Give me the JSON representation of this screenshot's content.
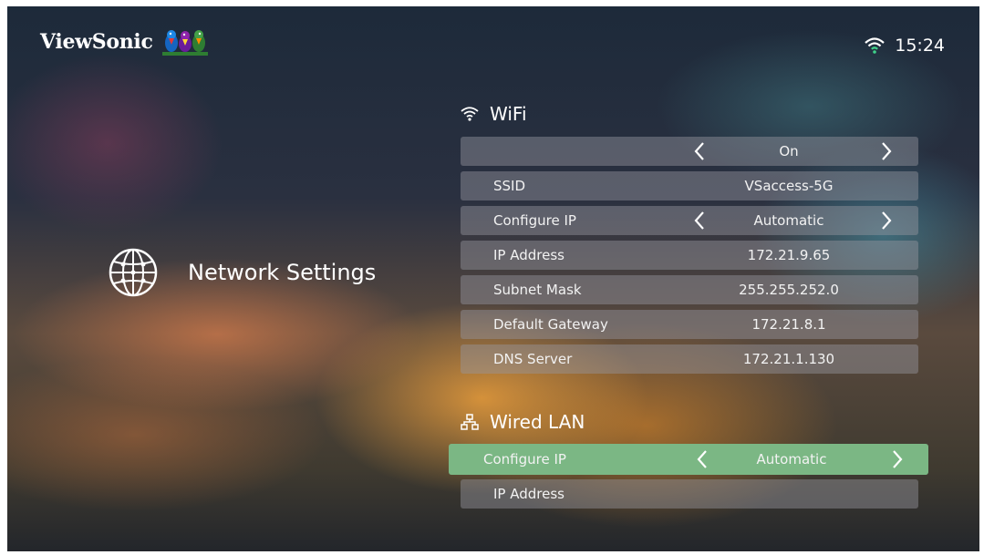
{
  "brand": {
    "logo_text": "ViewSonic"
  },
  "status_bar": {
    "time": "15:24",
    "wifi_icon": "wifi-icon"
  },
  "page": {
    "title": "Network Settings",
    "icon": "globe-icon"
  },
  "wifi": {
    "heading": "WiFi",
    "toggle": {
      "value": "On"
    },
    "ssid": {
      "label": "SSID",
      "value": "VSaccess-5G"
    },
    "configure_ip": {
      "label": "Configure IP",
      "value": "Automatic"
    },
    "ip_address": {
      "label": "IP Address",
      "value": "172.21.9.65"
    },
    "subnet_mask": {
      "label": "Subnet Mask",
      "value": "255.255.252.0"
    },
    "default_gateway": {
      "label": "Default Gateway",
      "value": "172.21.8.1"
    },
    "dns_server": {
      "label": "DNS Server",
      "value": "172.21.1.130"
    }
  },
  "wired": {
    "heading": "Wired LAN",
    "configure_ip": {
      "label": "Configure IP",
      "value": "Automatic"
    },
    "ip_address": {
      "label": "IP Address",
      "value": ""
    }
  },
  "colors": {
    "selected_row": "#7bb784",
    "row_bg": "#8f909c",
    "text": "#ffffff",
    "wifi_status": "#3fd28a"
  }
}
